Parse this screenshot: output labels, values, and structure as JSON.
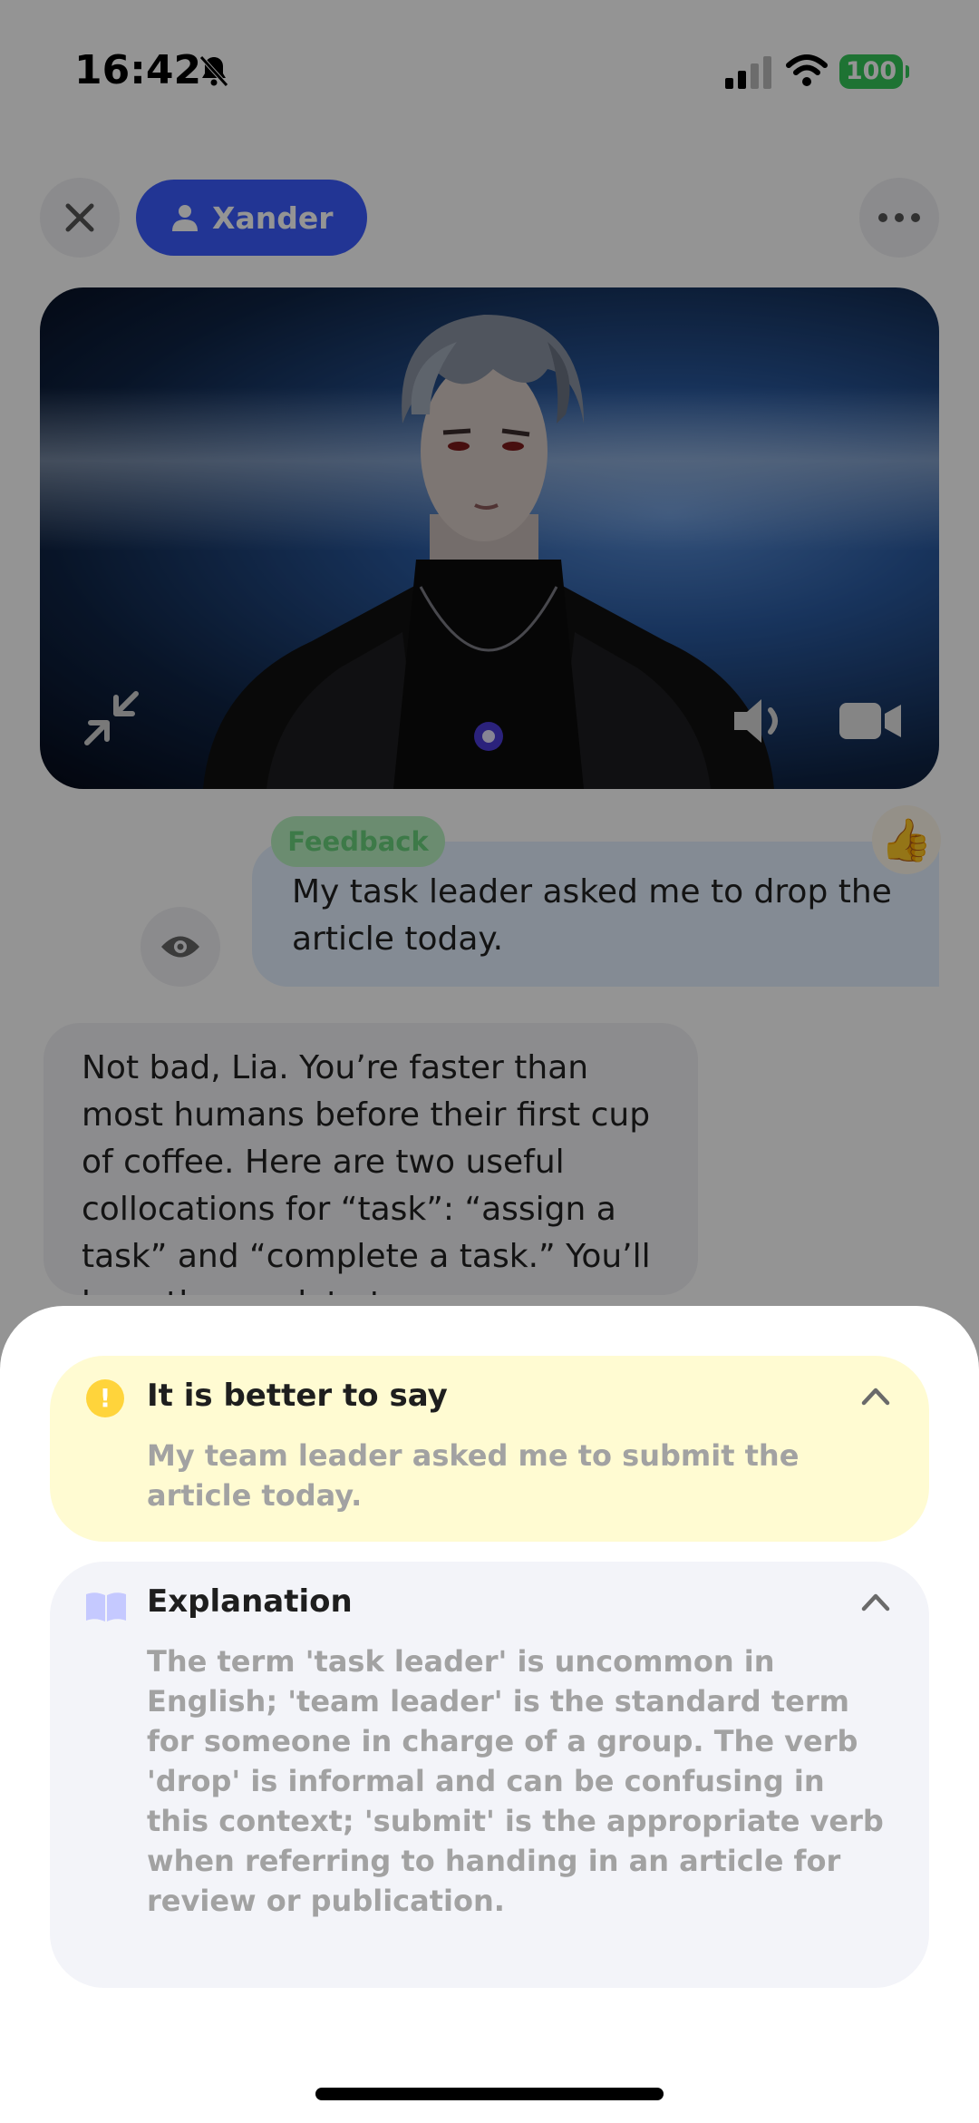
{
  "status_bar": {
    "time": "16:42",
    "battery": "100",
    "icons": [
      "bell-slash-icon",
      "signal-icon",
      "wifi-icon",
      "battery-icon"
    ]
  },
  "header": {
    "character_name": "Xander",
    "icons": [
      "close-icon",
      "person-icon",
      "more-icon"
    ]
  },
  "video": {
    "controls": [
      "collapse-icon",
      "volume-icon",
      "camera-icon"
    ]
  },
  "chat": {
    "user_message": "My task leader asked me to drop the article today.",
    "feedback_label": "Feedback",
    "reaction": "👍",
    "bot_message": "Not bad, Lia. You’re faster than most humans before their first cup of coffee. Here are two useful collocations for “task”: “assign a task” and “complete a task.” You’ll hear these a lot at"
  },
  "sheet": {
    "suggestion": {
      "title": "It is better to say",
      "icon": "!",
      "text": "My team leader asked me to submit the article today."
    },
    "explanation": {
      "title": "Explanation",
      "text": "The term 'task leader' is uncommon in English; 'team leader' is the standard term for someone in charge of a group. The verb 'drop' is informal and can be confusing in this context; 'submit' is the appropriate verb when referring to handing in an article for review or publication."
    }
  },
  "colors": {
    "accent_blue": "#3c5cff",
    "suggestion_bg": "#fffbd2",
    "explanation_bg": "#f3f4f9",
    "warning_yellow": "#ffd43b",
    "battery_green": "#34c759"
  }
}
